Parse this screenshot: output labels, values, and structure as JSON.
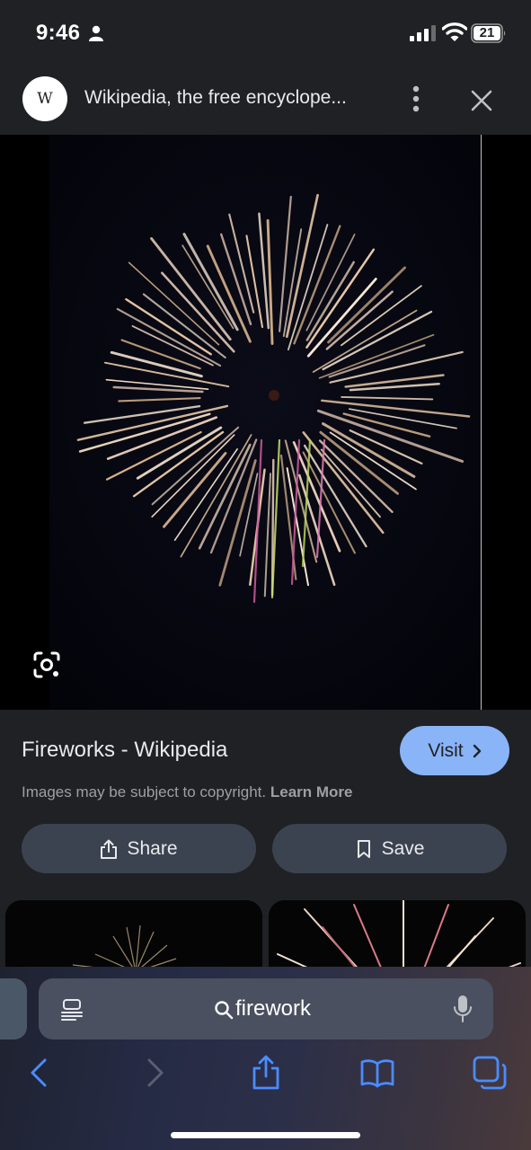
{
  "status_bar": {
    "time": "9:46",
    "battery_level": "21"
  },
  "header": {
    "site_logo": "W",
    "title": "Wikipedia, the free encyclope..."
  },
  "result": {
    "title": "Fireworks - Wikipedia",
    "visit_label": "Visit",
    "copyright_text": "Images may be subject to copyright.",
    "learn_more_label": "Learn More",
    "share_label": "Share",
    "save_label": "Save"
  },
  "browser": {
    "address_text": "firework"
  },
  "colors": {
    "accent": "#8ab4f8",
    "panel_bg": "#202124",
    "button_bg": "#3c4350",
    "link_blue": "#4a8cff"
  },
  "icons": [
    "person-icon",
    "signal-icon",
    "wifi-icon",
    "battery-icon",
    "more-icon",
    "close-icon",
    "lens-icon",
    "chevron-right-icon",
    "share-icon",
    "bookmark-icon",
    "reader-icon",
    "search-icon",
    "mic-icon",
    "back-icon",
    "forward-icon",
    "share-nav-icon",
    "bookmarks-icon",
    "tabs-icon"
  ]
}
